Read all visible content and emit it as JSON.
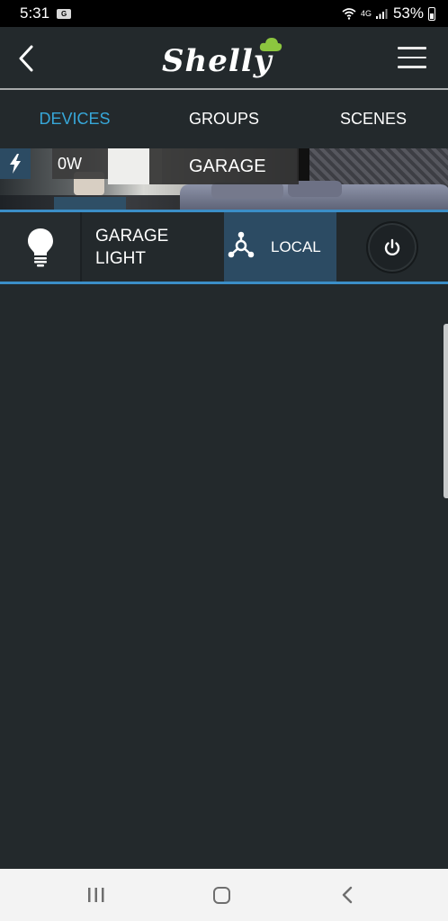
{
  "status_bar": {
    "time": "5:31",
    "notification_icon": "gallery-icon",
    "network": "4G",
    "battery": "53%"
  },
  "header": {
    "back_icon": "chevron-left-icon",
    "logo_text": "Shelly",
    "menu_icon": "hamburger-menu-icon"
  },
  "tabs": [
    {
      "label": "DEVICES",
      "active": true
    },
    {
      "label": "GROUPS",
      "active": false
    },
    {
      "label": "SCENES",
      "active": false
    }
  ],
  "room": {
    "energy_icon": "lightning-bolt-icon",
    "power": "0W",
    "name": "GARAGE"
  },
  "device": {
    "icon": "lightbulb-icon",
    "name": "GARAGE LIGHT",
    "connection_icon": "network-hub-icon",
    "connection": "LOCAL",
    "power_icon": "power-icon",
    "accent_color": "#37a7d9"
  },
  "nav_bar": {
    "recent_icon": "recent-apps-icon",
    "home_icon": "home-icon",
    "back_icon": "back-icon"
  }
}
